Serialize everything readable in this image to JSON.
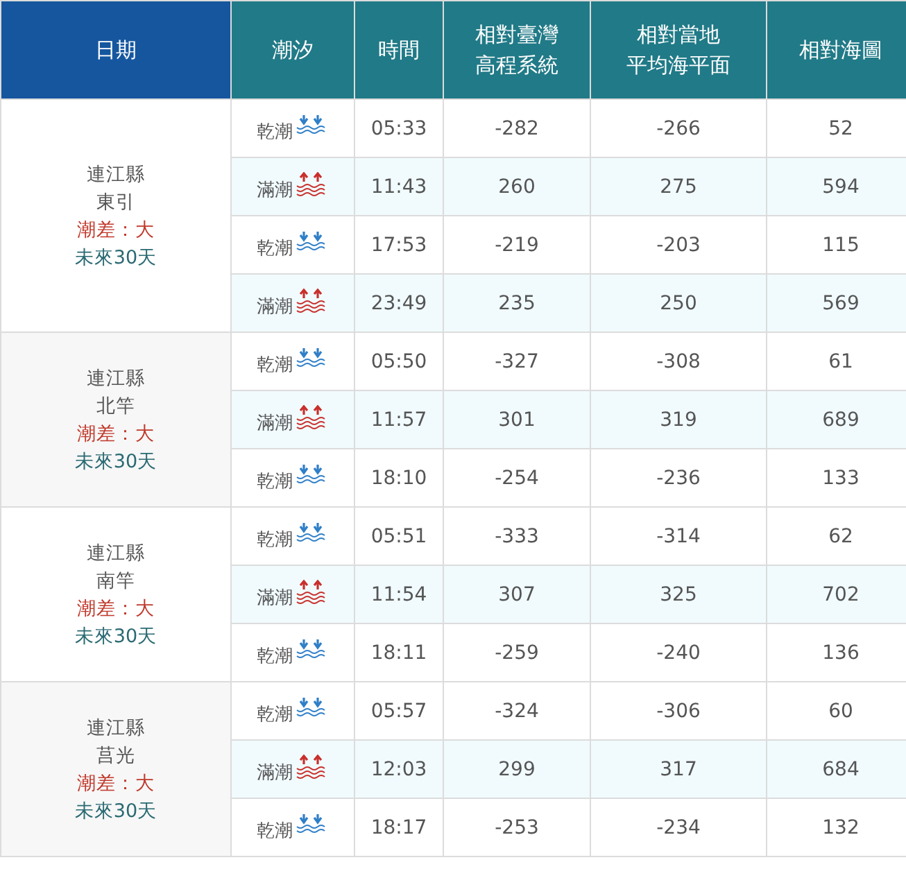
{
  "columns": [
    [
      "日期"
    ],
    [
      "潮汐"
    ],
    [
      "時間"
    ],
    [
      "相對臺灣",
      "高程系統"
    ],
    [
      "相對當地",
      "平均海平面"
    ],
    [
      "相對海圖"
    ]
  ],
  "stations": [
    {
      "county": "連江縣",
      "station": "東引",
      "range": "潮差：大",
      "link": "未來30天",
      "tides": [
        {
          "kind": "low",
          "label": "乾潮",
          "time": "05:33",
          "twvd": "-282",
          "local": "-266",
          "chart": "52"
        },
        {
          "kind": "high",
          "label": "滿潮",
          "time": "11:43",
          "twvd": "260",
          "local": "275",
          "chart": "594"
        },
        {
          "kind": "low",
          "label": "乾潮",
          "time": "17:53",
          "twvd": "-219",
          "local": "-203",
          "chart": "115"
        },
        {
          "kind": "high",
          "label": "滿潮",
          "time": "23:49",
          "twvd": "235",
          "local": "250",
          "chart": "569"
        }
      ]
    },
    {
      "county": "連江縣",
      "station": "北竿",
      "range": "潮差：大",
      "link": "未來30天",
      "tides": [
        {
          "kind": "low",
          "label": "乾潮",
          "time": "05:50",
          "twvd": "-327",
          "local": "-308",
          "chart": "61"
        },
        {
          "kind": "high",
          "label": "滿潮",
          "time": "11:57",
          "twvd": "301",
          "local": "319",
          "chart": "689"
        },
        {
          "kind": "low",
          "label": "乾潮",
          "time": "18:10",
          "twvd": "-254",
          "local": "-236",
          "chart": "133"
        }
      ]
    },
    {
      "county": "連江縣",
      "station": "南竿",
      "range": "潮差：大",
      "link": "未來30天",
      "tides": [
        {
          "kind": "low",
          "label": "乾潮",
          "time": "05:51",
          "twvd": "-333",
          "local": "-314",
          "chart": "62"
        },
        {
          "kind": "high",
          "label": "滿潮",
          "time": "11:54",
          "twvd": "307",
          "local": "325",
          "chart": "702"
        },
        {
          "kind": "low",
          "label": "乾潮",
          "time": "18:11",
          "twvd": "-259",
          "local": "-240",
          "chart": "136"
        }
      ]
    },
    {
      "county": "連江縣",
      "station": "莒光",
      "range": "潮差：大",
      "link": "未來30天",
      "tides": [
        {
          "kind": "low",
          "label": "乾潮",
          "time": "05:57",
          "twvd": "-324",
          "local": "-306",
          "chart": "60"
        },
        {
          "kind": "high",
          "label": "滿潮",
          "time": "12:03",
          "twvd": "299",
          "local": "317",
          "chart": "684"
        },
        {
          "kind": "low",
          "label": "乾潮",
          "time": "18:17",
          "twvd": "-253",
          "local": "-234",
          "chart": "132"
        }
      ]
    }
  ]
}
